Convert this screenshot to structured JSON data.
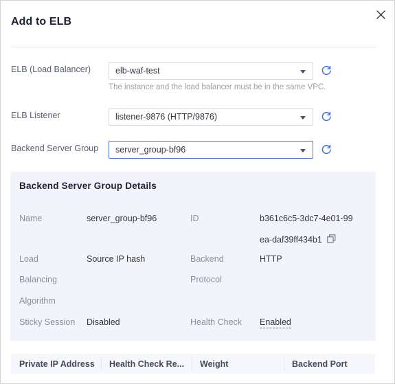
{
  "dialog": {
    "title": "Add to ELB",
    "close_icon": "close-icon"
  },
  "form": {
    "elb": {
      "label": "ELB (Load Balancer)",
      "value": "elb-waf-test",
      "helper": "The instance and the load balancer must be in the same VPC.",
      "refresh_icon": "refresh-icon"
    },
    "listener": {
      "label": "ELB Listener",
      "value": "listener-9876 (HTTP/9876)",
      "refresh_icon": "refresh-icon"
    },
    "backend_group": {
      "label": "Backend Server Group",
      "value": "server_group-bf96",
      "refresh_icon": "refresh-icon"
    }
  },
  "details": {
    "title": "Backend Server Group Details",
    "name_label": "Name",
    "name_value": "server_group-bf96",
    "id_label": "ID",
    "id_value_line1": "b361c6c5-3dc7-4e01-99",
    "id_value_line2": "ea-daf39ff434b1",
    "copy_icon": "copy-icon",
    "lb_label_line1": "Load",
    "lb_label_line2": "Balancing",
    "lb_label_line3": "Algorithm",
    "lb_value": "Source IP hash",
    "protocol_label_line1": "Backend",
    "protocol_label_line2": "Protocol",
    "protocol_value": "HTTP",
    "sticky_label": "Sticky Session",
    "sticky_value": "Disabled",
    "health_label": "Health Check",
    "health_value": "Enabled"
  },
  "table": {
    "columns": [
      {
        "label": "Private IP Address"
      },
      {
        "label": "Health Check Re..."
      },
      {
        "label": "Weight"
      },
      {
        "label": "Backend Port"
      }
    ]
  },
  "colors": {
    "accent": "#4c6fd6",
    "panel_bg": "#f2f4fb",
    "label": "#8b8f99",
    "text": "#333840"
  }
}
